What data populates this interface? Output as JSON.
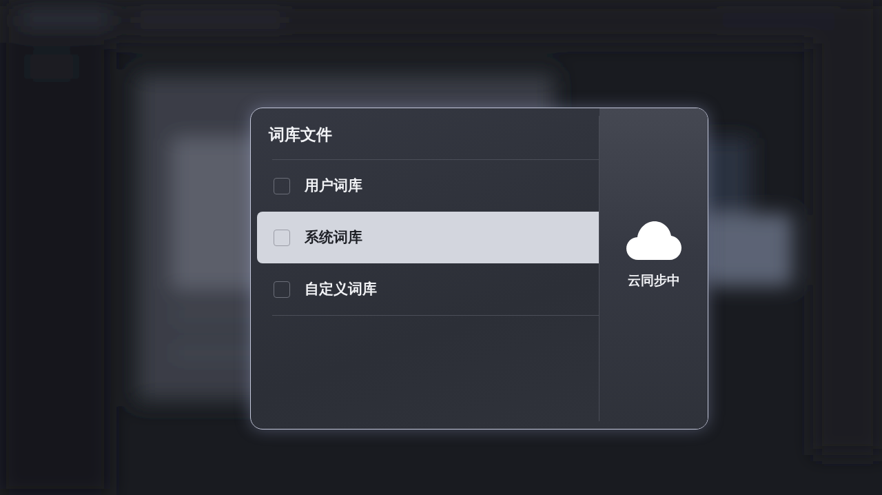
{
  "dialog": {
    "title": "词库文件",
    "items": [
      {
        "label": "用户词库",
        "checked": false,
        "selected": false
      },
      {
        "label": "系统词库",
        "checked": false,
        "selected": true
      },
      {
        "label": "自定义词库",
        "checked": false,
        "selected": false
      }
    ],
    "sync_panel": {
      "status": "云同步中"
    }
  }
}
